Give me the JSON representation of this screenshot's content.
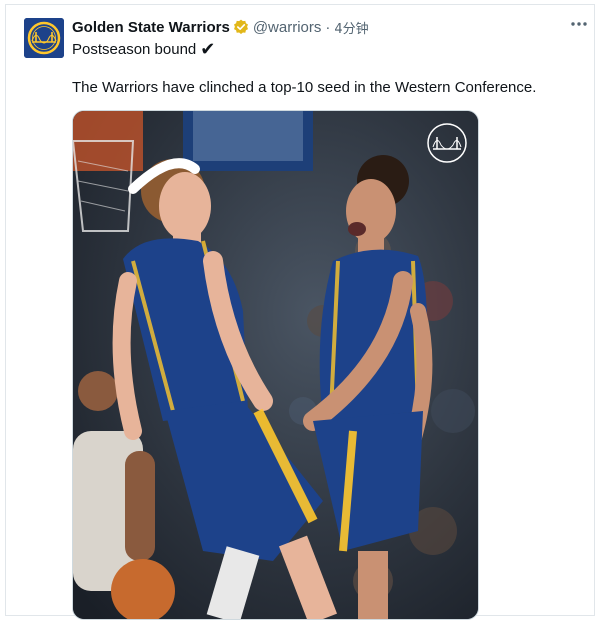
{
  "post": {
    "display_name": "Golden State Warriors",
    "handle": "@warriors",
    "separator": "·",
    "timestamp": "4分钟",
    "title_text": "Postseason bound",
    "title_emoji": "✔",
    "body_text": "The Warriors have clinched a top-10 seed in the Western Conference."
  },
  "icons": {
    "avatar": "warriors-logo-icon",
    "verified": "verified-badge-icon",
    "more": "more-options-icon",
    "watermark": "warriors-logo-icon"
  },
  "colors": {
    "warriors_blue": "#1d428a",
    "warriors_gold": "#ffc72c",
    "verified_gold": "#e2b719",
    "secondary_text": "#536471"
  },
  "media": {
    "alt": "Two Golden State Warriors players celebrating on court"
  }
}
